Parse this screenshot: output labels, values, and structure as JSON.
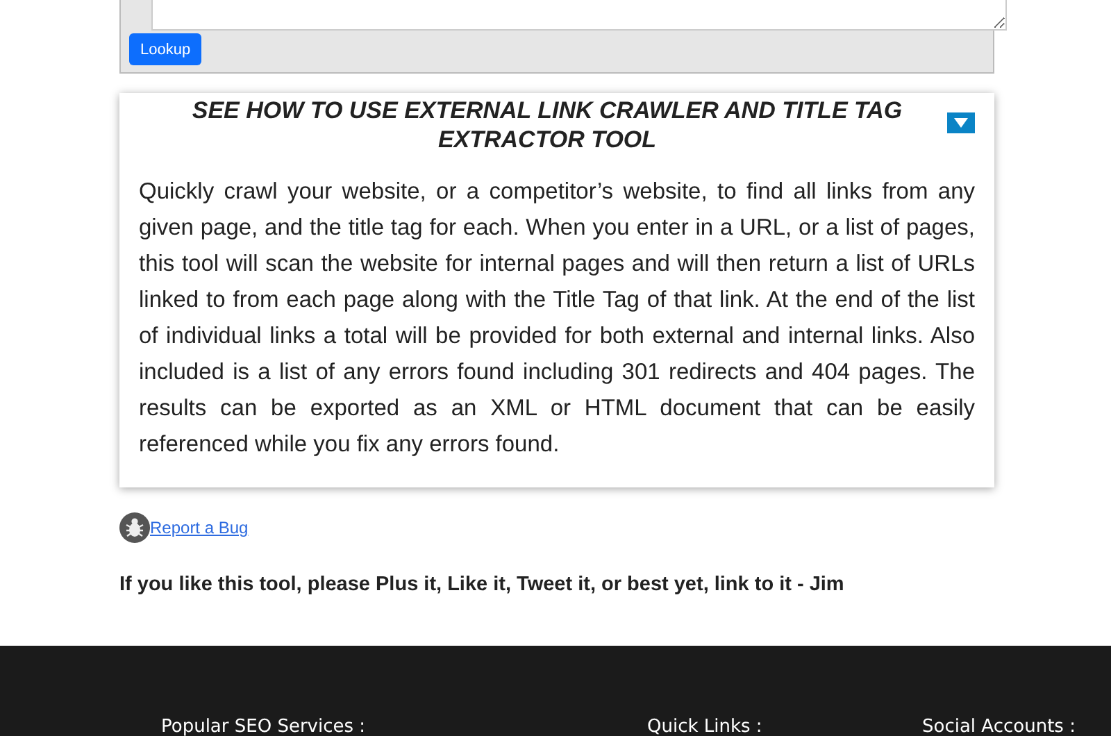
{
  "lookup_button": "Lookup",
  "howto": {
    "title": "SEE HOW TO USE EXTERNAL LINK CRAWLER AND TITLE TAG EXTRACTOR TOOL",
    "expanded": true,
    "text": "Quickly crawl your website, or a competitor’s website, to find all links from any given page, and the title tag for each. When you enter in a URL, or a list of pages, this tool will scan the website for internal pages and will then return a list of URLs linked to from each page along with the Title Tag of that link. At the end of the list of individual links a total will be provided for both external and internal links. Also included is a list of any errors found including 301 redirects and 404 pages. The results can be exported as an XML or HTML document that can be easily referenced while you fix any errors found."
  },
  "report_link": "Report a Bug",
  "plea": "If you like this tool, please Plus it, Like it, Tweet it, or best yet, link to it - Jim",
  "footer_headings": [
    "Popular SEO Services :",
    "Quick Links :",
    "Social Accounts :"
  ]
}
